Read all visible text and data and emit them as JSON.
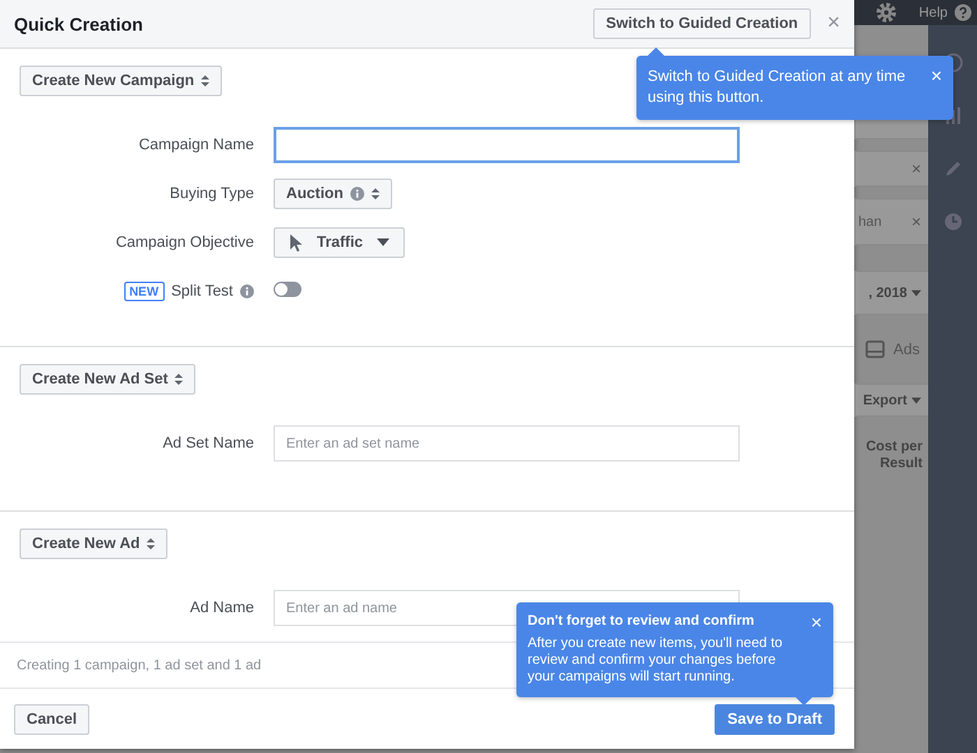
{
  "modal": {
    "title": "Quick Creation",
    "guided_button": "Switch to Guided Creation",
    "close": "×"
  },
  "sections": [
    {
      "button": "Create New Campaign",
      "fields": [
        {
          "kind": "text",
          "label": "Campaign Name",
          "focused": true
        },
        {
          "kind": "select",
          "label": "Buying Type",
          "value": "Auction",
          "info": true
        },
        {
          "kind": "dropdown",
          "label": "Campaign Objective",
          "value": "Traffic"
        },
        {
          "kind": "toggle",
          "badge": "NEW",
          "label": "Split Test",
          "info": true,
          "on": false
        }
      ]
    },
    {
      "button": "Create New Ad Set",
      "fields": [
        {
          "kind": "text",
          "label": "Ad Set Name",
          "placeholder": "Enter an ad set name",
          "focused": false
        }
      ]
    },
    {
      "button": "Create New Ad",
      "fields": [
        {
          "kind": "text",
          "label": "Ad Name",
          "placeholder": "Enter an ad name",
          "focused": false
        }
      ]
    }
  ],
  "summary": "Creating 1 campaign, 1 ad set and 1 ad",
  "footer": {
    "cancel": "Cancel",
    "save": "Save to Draft"
  },
  "tooltips": [
    {
      "kind": "top",
      "text": "Switch to Guided Creation at any time using this button.",
      "close": "×"
    },
    {
      "kind": "bottom",
      "title": "Don't forget to review and confirm",
      "text": "After you create new items, you'll need to review and confirm your changes before your campaigns will start running.",
      "close": "×"
    }
  ],
  "background": {
    "help": "Help",
    "cards": [
      {
        "close": "×"
      },
      {
        "text": "han",
        "close": "×"
      }
    ],
    "date": ", 2018",
    "tab": "Ads",
    "export": "Export",
    "column": "Cost per Result"
  }
}
